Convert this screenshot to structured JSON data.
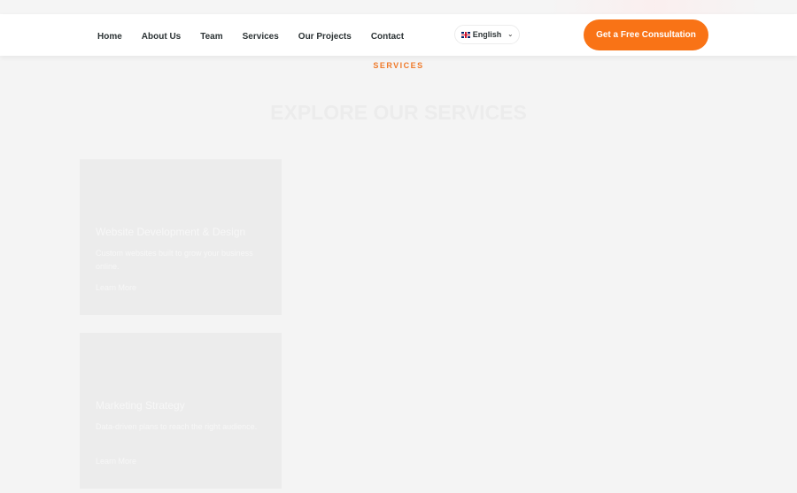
{
  "nav": {
    "items": [
      {
        "label": "Home"
      },
      {
        "label": "About Us"
      },
      {
        "label": "Team"
      },
      {
        "label": "Services"
      },
      {
        "label": "Our Projects"
      },
      {
        "label": "Contact"
      }
    ],
    "language": {
      "label": "English",
      "flag_icon": "uk-flag-icon",
      "chevron_icon": "chevron-down-icon"
    },
    "cta_label": "Get a Free Consultation"
  },
  "services": {
    "eyebrow": "SERVICES",
    "title": "EXPLORE OUR SERVICES",
    "cards": [
      {
        "title": "Website Development & Design",
        "description": "Custom websites built to grow your business online.",
        "link": "Learn More"
      },
      {
        "title": "Marketing Strategy",
        "description": "Data-driven plans to reach the right audience.",
        "link": "Learn More"
      }
    ]
  },
  "colors": {
    "accent": "#f97316",
    "eyebrow": "#ef7a2a",
    "nav_text": "#2d3436",
    "background": "#f4f4f4",
    "card": "#ececec"
  }
}
